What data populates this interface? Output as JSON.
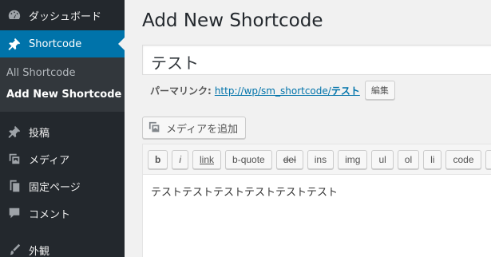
{
  "sidebar": {
    "items_top": [
      {
        "label": "ダッシュボード",
        "icon": "dashboard-icon"
      },
      {
        "label": "Shortcode",
        "icon": "pin-icon",
        "active": true
      }
    ],
    "submenu": [
      {
        "label": "All Shortcode"
      },
      {
        "label": "Add New Shortcode",
        "current": true
      }
    ],
    "items_bottom": [
      {
        "label": "投稿",
        "icon": "pin-icon"
      },
      {
        "label": "メディア",
        "icon": "media-icon"
      },
      {
        "label": "固定ページ",
        "icon": "pages-icon"
      },
      {
        "label": "コメント",
        "icon": "comment-icon"
      },
      {
        "label": "外観",
        "icon": "brush-icon"
      }
    ]
  },
  "main": {
    "title": "Add New Shortcode",
    "post_title": "テスト",
    "permalink": {
      "label": "パーマリンク:",
      "url_prefix": "http://wp/sm_shortcode/",
      "slug": "テスト",
      "edit_label": "編集"
    },
    "media_button": "メディアを追加",
    "quicktags": [
      "b",
      "i",
      "link",
      "b-quote",
      "del",
      "ins",
      "img",
      "ul",
      "ol",
      "li",
      "code",
      "m"
    ],
    "content": "テストテストテストテストテストテスト"
  },
  "colors": {
    "sidebar_bg": "#23282d",
    "active_bg": "#0073aa",
    "submenu_bg": "#32373c",
    "link": "#0073aa"
  }
}
